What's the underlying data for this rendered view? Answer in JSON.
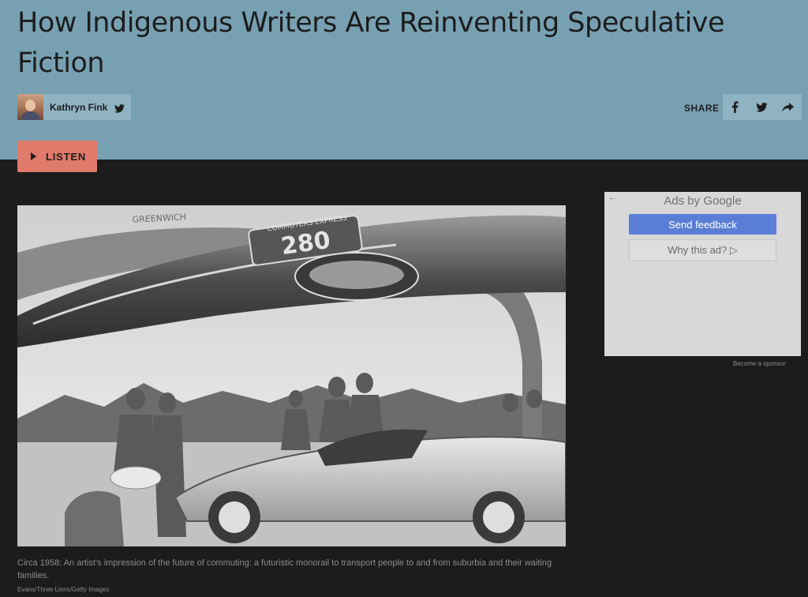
{
  "article": {
    "title": "How Indigenous Writers Are Reinventing Speculative Fiction",
    "author": "Kathryn Fink",
    "share_label": "SHARE",
    "listen_label": "LISTEN",
    "caption": "Circa 1958: An artist's impression of the future of commuting: a futuristic monorail to transport people to and from suburbia and their waiting families.",
    "credit": "Evans/Three Lions/Getty Images"
  },
  "photo": {
    "sign_text": "GREENWICH",
    "train_text": "COMMUTERS EXPRESS",
    "train_number": "280"
  },
  "ad": {
    "back_glyph": "←",
    "title": "Ads by Google",
    "feedback_label": "Send feedback",
    "why_label": "Why this ad? ▷",
    "sponsor_label": "Become a sponsor"
  },
  "icons": {
    "author_twitter": "twitter-icon",
    "share_facebook": "facebook-icon",
    "share_twitter": "twitter-icon",
    "share_more": "share-arrow-icon",
    "listen": "play-icon"
  },
  "colors": {
    "header_bg": "#77a1b3",
    "listen_bg": "#e07a6a",
    "ad_button": "#5a7ed6",
    "page_bg": "#1c1c1c"
  }
}
